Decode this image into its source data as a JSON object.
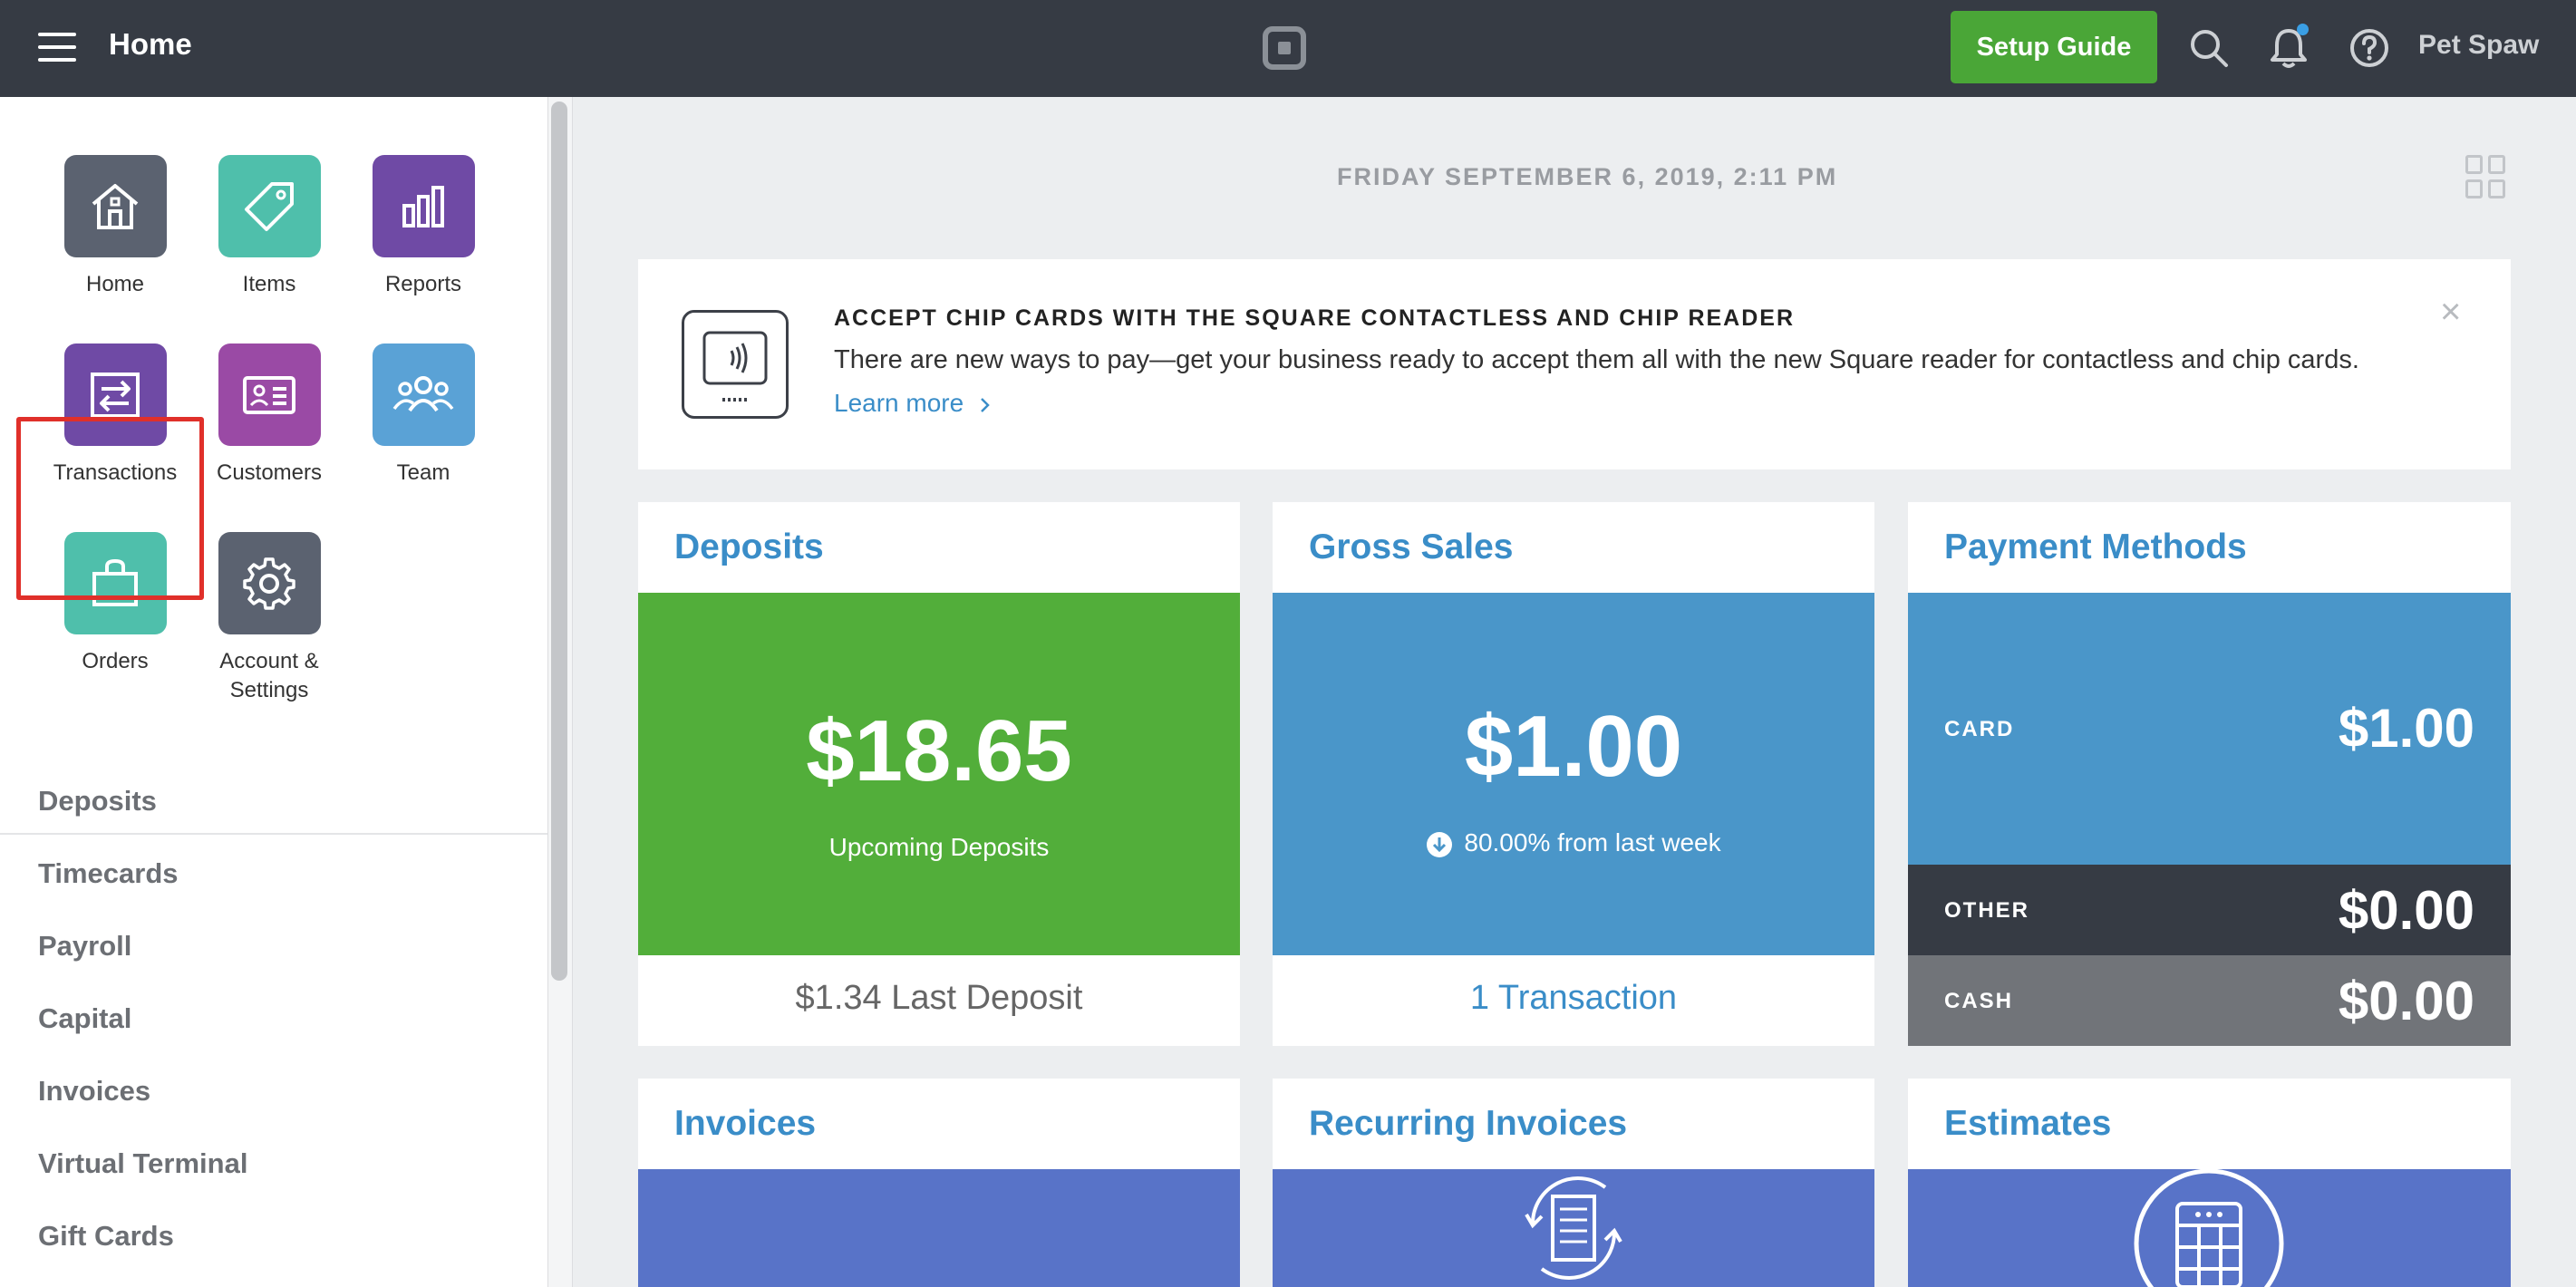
{
  "header": {
    "title": "Home",
    "setup_label": "Setup Guide",
    "user_name": "Pet Spaw"
  },
  "sidebar": {
    "apps": [
      {
        "label": "Home",
        "color": "#5b6270"
      },
      {
        "label": "Items",
        "color": "#4fbfab"
      },
      {
        "label": "Reports",
        "color": "#6f4aa5"
      },
      {
        "label": "Transactions",
        "color": "#6f4aa5"
      },
      {
        "label": "Customers",
        "color": "#9a4aa5"
      },
      {
        "label": "Team",
        "color": "#5aa2d6"
      },
      {
        "label": "Orders",
        "color": "#4fbfab"
      },
      {
        "label": "Account &",
        "label2": "Settings",
        "color": "#5b6270"
      }
    ],
    "links": [
      "Deposits",
      "Timecards",
      "Payroll",
      "Capital",
      "Invoices",
      "Virtual Terminal",
      "Gift Cards"
    ]
  },
  "main": {
    "date": "FRIDAY SEPTEMBER 6, 2019, 2:11 PM",
    "banner": {
      "title": "ACCEPT CHIP CARDS WITH THE SQUARE CONTACTLESS AND CHIP READER",
      "body": "There are new ways to pay—get your business ready to accept them all with the new Square reader for contactless and chip cards.",
      "link": "Learn more"
    },
    "deposits": {
      "title": "Deposits",
      "amount": "$18.65",
      "subtitle": "Upcoming Deposits",
      "footer": "$1.34 Last Deposit",
      "color": "#52ae3a"
    },
    "gross_sales": {
      "title": "Gross Sales",
      "amount": "$1.00",
      "change": "80.00% from last week",
      "footer": "1 Transaction",
      "color": "#4a96c9"
    },
    "payment_methods": {
      "title": "Payment Methods",
      "rows": [
        {
          "label": "CARD",
          "value": "$1.00",
          "color": "#4a96c9"
        },
        {
          "label": "OTHER",
          "value": "$0.00",
          "color": "#363b44"
        },
        {
          "label": "CASH",
          "value": "$0.00",
          "color": "#717479"
        }
      ]
    },
    "invoices": {
      "title": "Invoices"
    },
    "recurring_invoices": {
      "title": "Recurring Invoices"
    },
    "estimates": {
      "title": "Estimates"
    },
    "card_color_purple_blue": "#5873c8"
  }
}
